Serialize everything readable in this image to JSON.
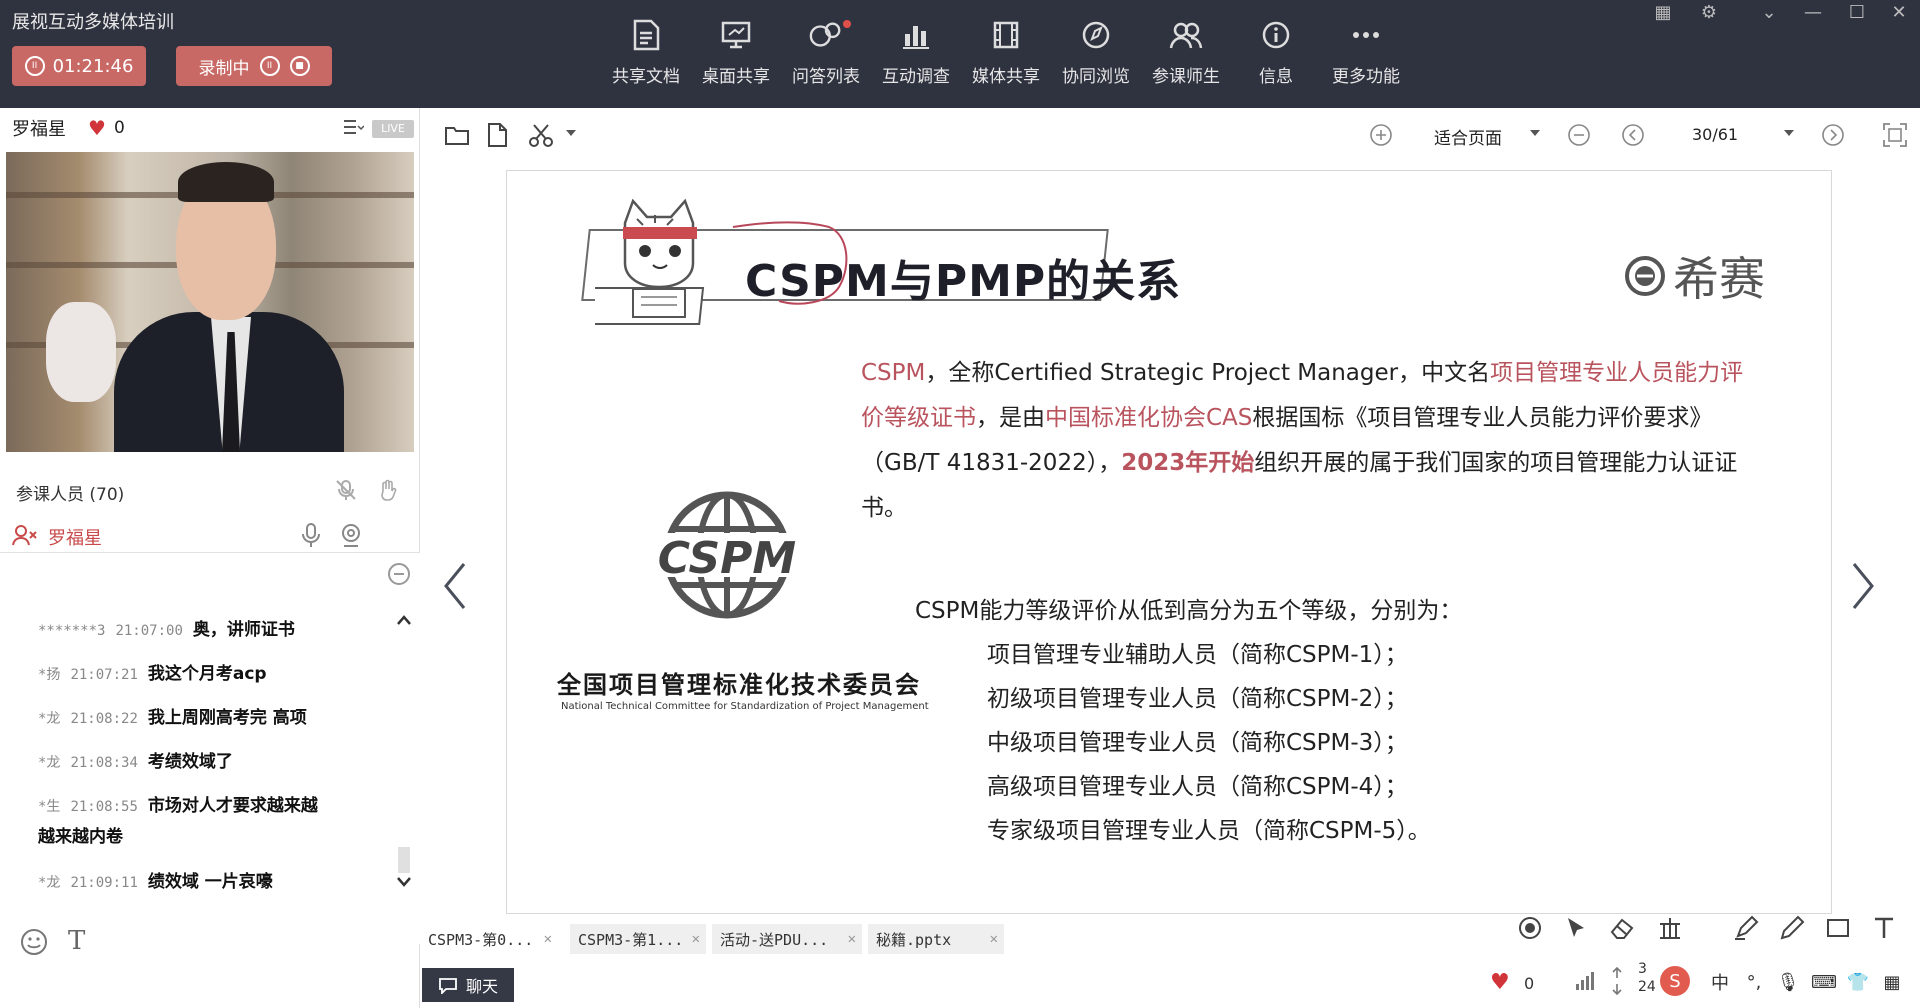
{
  "app": {
    "title": "展视互动多媒体培训"
  },
  "status": {
    "timer": "01:21:46",
    "recording_label": "录制中"
  },
  "toolbar": {
    "items": [
      {
        "label": "共享文档",
        "icon": "document-share-icon"
      },
      {
        "label": "桌面共享",
        "icon": "desktop-share-icon"
      },
      {
        "label": "问答列表",
        "icon": "qa-list-icon"
      },
      {
        "label": "互动调查",
        "icon": "survey-icon"
      },
      {
        "label": "媒体共享",
        "icon": "media-share-icon"
      },
      {
        "label": "协同浏览",
        "icon": "co-browse-icon"
      },
      {
        "label": "参课师生",
        "icon": "participants-icon"
      },
      {
        "label": "信息",
        "icon": "info-icon"
      },
      {
        "label": "更多功能",
        "icon": "more-icon"
      }
    ]
  },
  "host": {
    "name": "罗福星",
    "likes": "0",
    "live_badge": "LIVE"
  },
  "participants": {
    "label": "参课人员 (70)",
    "member_name": "罗福星"
  },
  "chat": {
    "messages": [
      {
        "user": "*******3",
        "time": "21:07:00",
        "text": "奥，讲师证书"
      },
      {
        "user": "*扬",
        "time": "21:07:21",
        "text": "我这个月考acp"
      },
      {
        "user": "*龙",
        "time": "21:08:22",
        "text": "我上周刚高考完 高项"
      },
      {
        "user": "*龙",
        "time": "21:08:34",
        "text": "考绩效域了"
      },
      {
        "user": "*生",
        "time": "21:08:55",
        "text": "市场对人才要求越来越",
        "text2": "越来越内卷"
      },
      {
        "user": "*龙",
        "time": "21:09:11",
        "text": "绩效域 一片哀嚎"
      }
    ]
  },
  "doc": {
    "zoom": "适合页面",
    "page": "30/61"
  },
  "slide": {
    "title": "CSPM与PMP的关系",
    "brand": "希赛",
    "intro": {
      "p1": "CSPM",
      "p2": "，全称Certified Strategic Project Manager，中文名",
      "p3": "项目管理专业人员能力评价等级证书",
      "p4": "，是由",
      "p5": "中国标准化协会CAS",
      "p6": "根据国标《项目管理专业人员能力评价要求》（GB/T 41831-2022），",
      "p7": "2023年开始",
      "p8": "组织开展的属于我们国家的项目管理能力认证证书。"
    },
    "logo_text": "CSPM",
    "committee_cn": "全国项目管理标准化技术委员会",
    "committee_en": "National Technical Committee for Standardization of Project Management",
    "levels_intro": "CSPM能力等级评价从低到高分为五个等级，分别为：",
    "levels": [
      "项目管理专业辅助人员（简称CSPM-1）；",
      "初级项目管理专业人员（简称CSPM-2）；",
      "中级项目管理专业人员（简称CSPM-3）；",
      "高级项目管理专业人员（简称CSPM-4）；",
      "专家级项目管理专业人员（简称CSPM-5）。"
    ]
  },
  "file_tabs": [
    "CSPM3-第0...",
    "CSPM3-第1...",
    "活动-送PDU...",
    "秘籍.pptx"
  ],
  "bottom": {
    "chat_tab": "聊天",
    "likes": "0",
    "count_top": "3",
    "count_bottom": "24"
  },
  "colors": {
    "topbar": "#2f3340",
    "accent": "#c96966",
    "highlight": "#b9545e"
  }
}
